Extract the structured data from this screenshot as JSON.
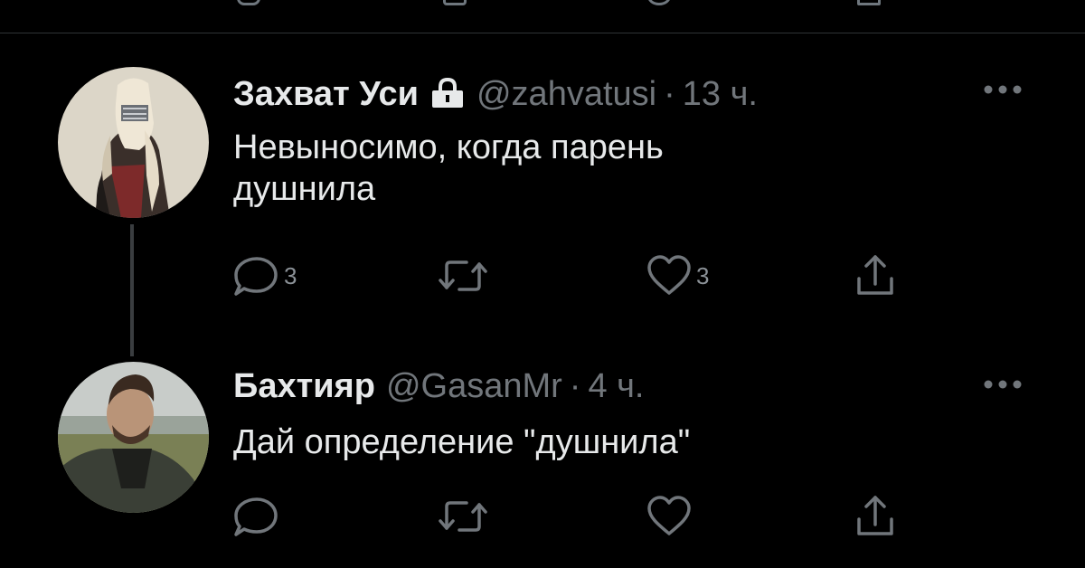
{
  "colors": {
    "background": "#000000",
    "primary_text": "#e7e9ea",
    "secondary_text": "#71767b",
    "divider": "#2f3336"
  },
  "tweets": [
    {
      "name": "Захват Уси",
      "protected": true,
      "handle": "@zahvatusi",
      "separator": "·",
      "time": "13 ч.",
      "text_line1": "Невыносимо, когда парень",
      "text_line2": "душнила",
      "actions": {
        "reply_icon": "reply-icon",
        "reply_count": "3",
        "retweet_icon": "retweet-icon",
        "retweet_count": "",
        "like_icon": "heart-icon",
        "like_count": "3",
        "share_icon": "share-icon"
      }
    },
    {
      "name": "Бахтияр",
      "protected": false,
      "handle": "@GasanMr",
      "separator": "·",
      "time": "4 ч.",
      "text_line1": "Дай определение \"душнила\"",
      "actions": {
        "reply_icon": "reply-icon",
        "reply_count": "",
        "retweet_icon": "retweet-icon",
        "retweet_count": "",
        "like_icon": "heart-icon",
        "like_count": "",
        "share_icon": "share-icon"
      }
    }
  ]
}
